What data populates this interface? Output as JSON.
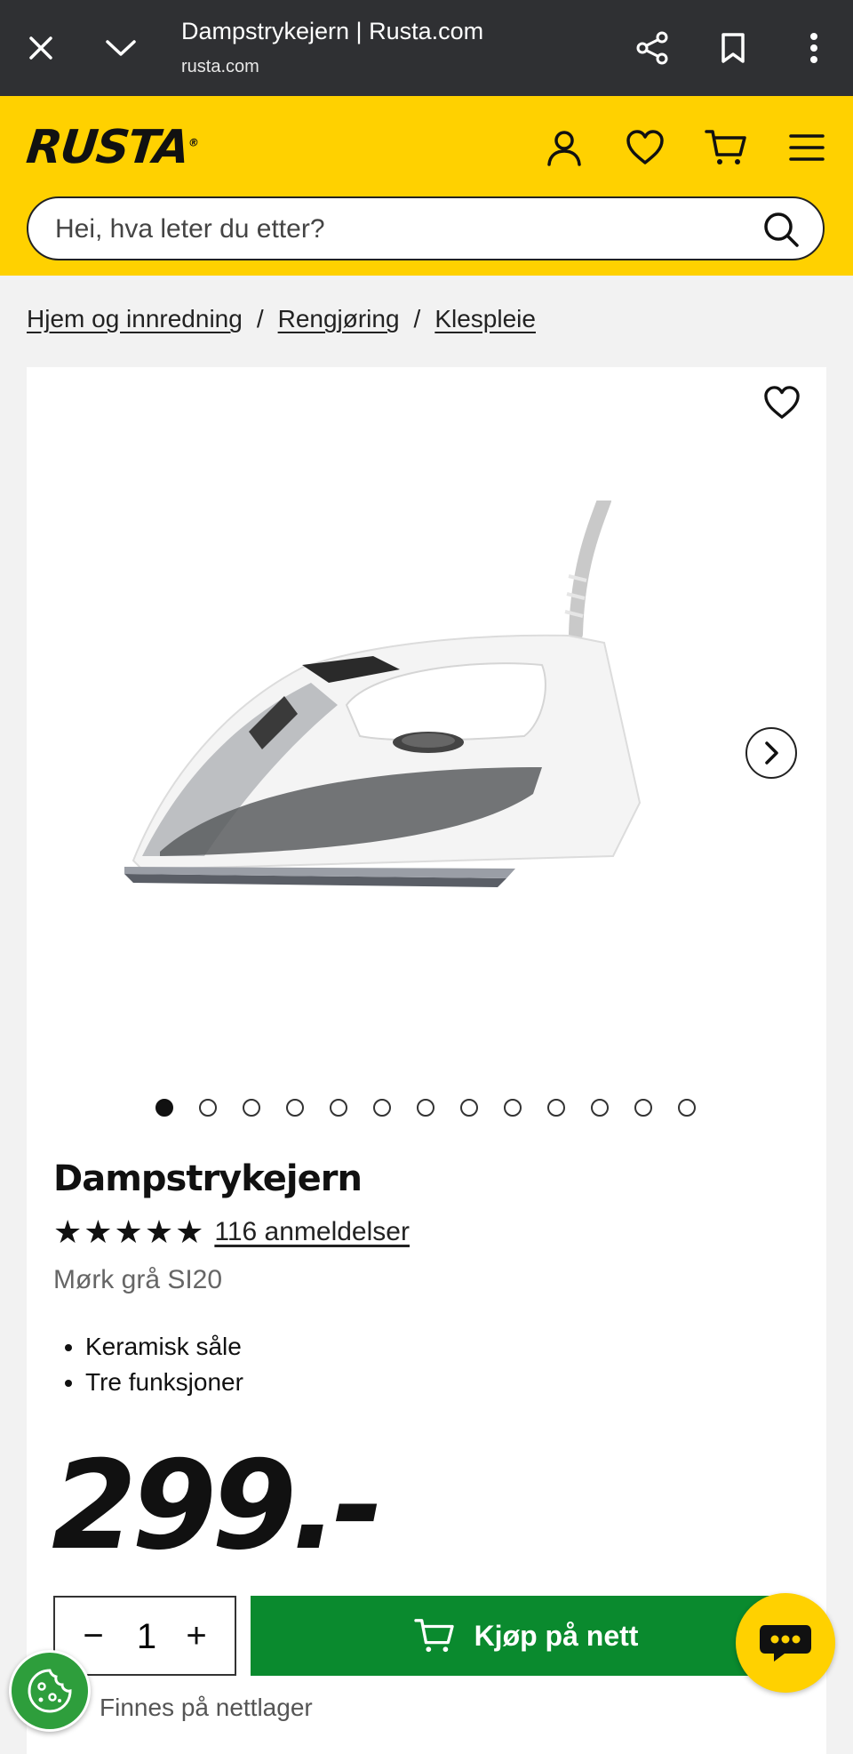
{
  "browser": {
    "title": "Dampstrykejern | Rusta.com",
    "url": "rusta.com",
    "icons": [
      "close-icon",
      "chevron-down-icon",
      "share-icon",
      "bookmark-icon",
      "more-vertical-icon"
    ]
  },
  "header": {
    "logo": "RUSTA",
    "logo_mark": "®",
    "icons": [
      "user-icon",
      "heart-icon",
      "cart-icon",
      "menu-icon"
    ],
    "search_placeholder": "Hei, hva leter du etter?"
  },
  "breadcrumb": [
    "Hjem og innredning",
    "Rengjøring",
    "Klespleie"
  ],
  "breadcrumb_separator": "/",
  "product": {
    "title": "Dampstrykejern",
    "stars": "★★★★★",
    "rating": 4.5,
    "reviews_label": "116 anmeldelser",
    "variant": "Mørk grå SI20",
    "features": [
      "Keramisk såle",
      "Tre funksjoner"
    ],
    "price": "299.-",
    "image_count": 13,
    "active_image": 1,
    "quantity": "1",
    "qty_minus": "−",
    "qty_plus": "+",
    "buy_label": "Kjøp på nett",
    "stock_text": "Finnes på nettlager"
  },
  "colors": {
    "brand_yellow": "#ffd100",
    "buy_green": "#0a8a2e",
    "browser_bar": "#2f3033"
  }
}
